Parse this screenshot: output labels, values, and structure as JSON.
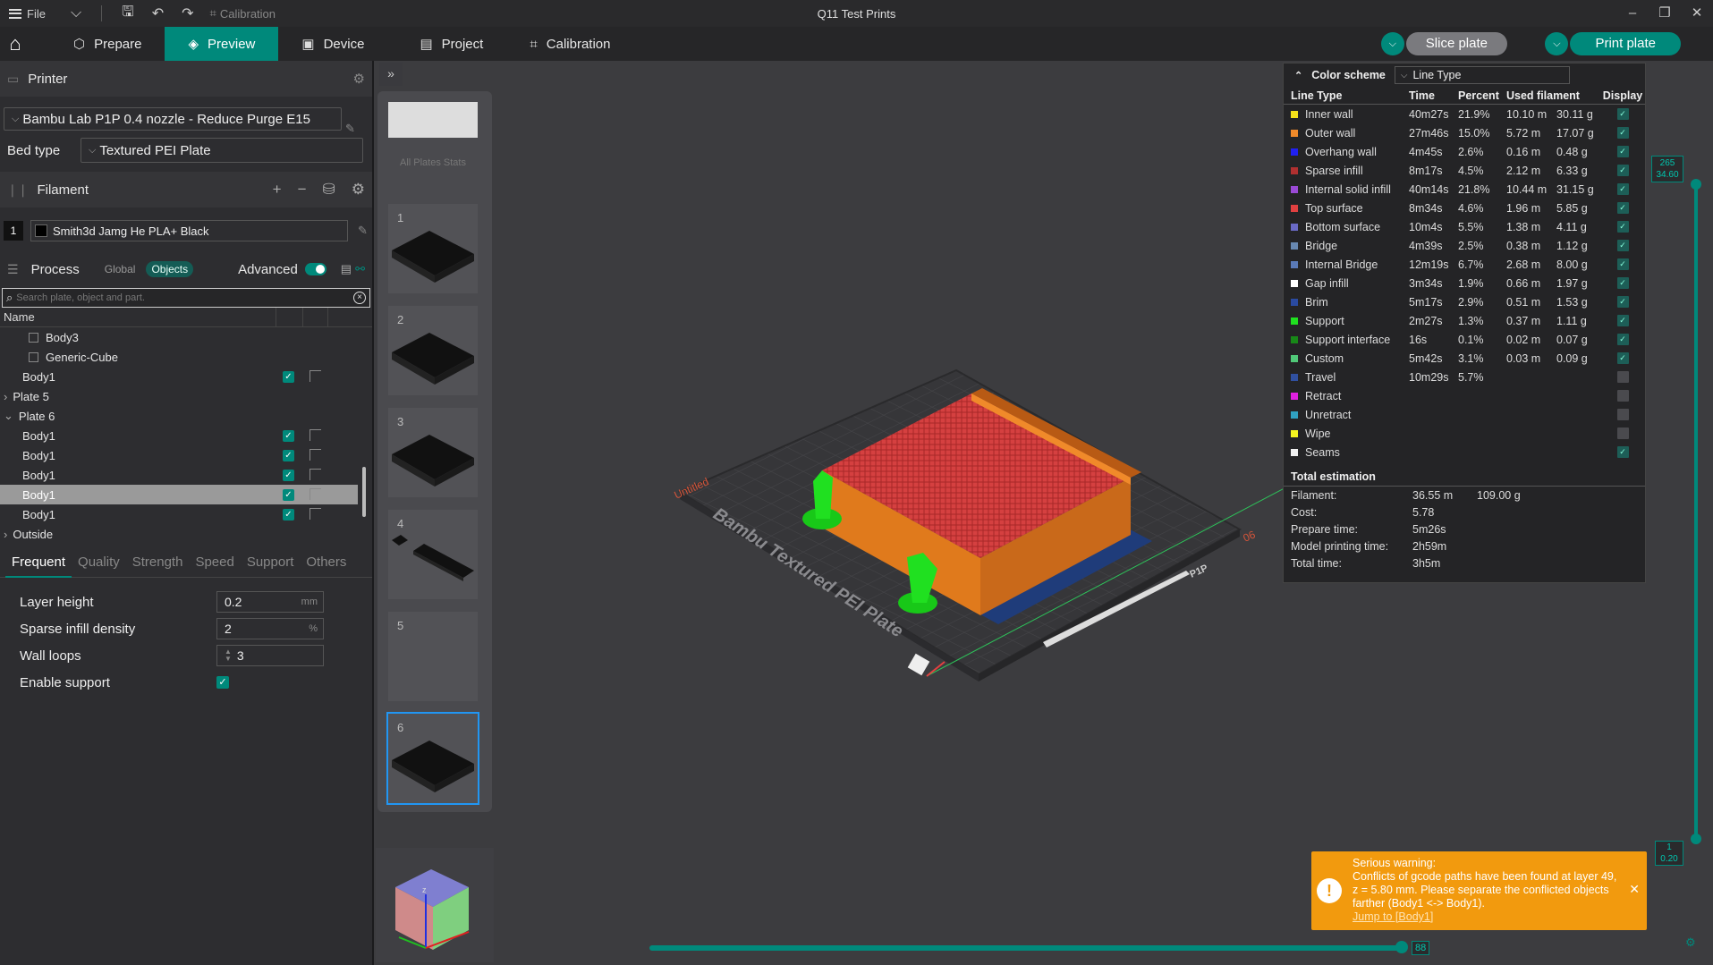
{
  "titlebar": {
    "file_label": "File",
    "calibration_label": "Calibration",
    "doc_title": "Q11 Test Prints"
  },
  "tabs": {
    "prepare": "Prepare",
    "preview": "Preview",
    "device": "Device",
    "project": "Project",
    "calibration": "Calibration",
    "slice_plate": "Slice plate",
    "print_plate": "Print plate"
  },
  "printer": {
    "section_title": "Printer",
    "preset": "Bambu Lab P1P 0.4 nozzle - Reduce Purge E15",
    "bed_type_label": "Bed type",
    "bed_type": "Textured PEI Plate"
  },
  "filament": {
    "section_title": "Filament",
    "slot": "1",
    "name": "Smith3d Jamg He PLA+ Black",
    "color": "#000000"
  },
  "process": {
    "section_title": "Process",
    "global": "Global",
    "objects": "Objects",
    "advanced": "Advanced",
    "search_placeholder": "Search plate, object and part.",
    "name_header": "Name",
    "tree": [
      "Body3",
      "Generic-Cube",
      "Body1",
      "Plate 5",
      "Plate 6",
      "Body1",
      "Body1",
      "Body1",
      "Body1",
      "Body1",
      "Outside"
    ]
  },
  "param_tabs": [
    "Frequent",
    "Quality",
    "Strength",
    "Speed",
    "Support",
    "Others"
  ],
  "params": {
    "layer_height_label": "Layer height",
    "layer_height": "0.2",
    "layer_height_unit": "mm",
    "sparse_infill_label": "Sparse infill density",
    "sparse_infill": "2",
    "sparse_infill_unit": "%",
    "wall_loops_label": "Wall loops",
    "wall_loops": "3",
    "enable_support_label": "Enable support"
  },
  "plates": {
    "all_label": "All Plates Stats",
    "numbers": [
      "1",
      "2",
      "3",
      "4",
      "5",
      "6"
    ]
  },
  "bed": {
    "plate_text": "Bambu Textured PEI Plate",
    "untitled": "Untitled",
    "plate_number": "06",
    "model_label": "P1P"
  },
  "legend": {
    "color_scheme_label": "Color scheme",
    "color_scheme": "Line Type",
    "headers": [
      "Line Type",
      "Time",
      "Percent",
      "Used filament",
      "Display"
    ],
    "rows": [
      {
        "name": "Inner wall",
        "time": "40m27s",
        "pct": "21.9%",
        "len": "10.10 m",
        "wt": "30.11 g",
        "color": "#f5e11a",
        "on": true
      },
      {
        "name": "Outer wall",
        "time": "27m46s",
        "pct": "15.0%",
        "len": "5.72 m",
        "wt": "17.07 g",
        "color": "#f08a2a",
        "on": true
      },
      {
        "name": "Overhang wall",
        "time": "4m45s",
        "pct": "2.6%",
        "len": "0.16 m",
        "wt": "0.48 g",
        "color": "#2020f0",
        "on": true
      },
      {
        "name": "Sparse infill",
        "time": "8m17s",
        "pct": "4.5%",
        "len": "2.12 m",
        "wt": "6.33 g",
        "color": "#b03030",
        "on": true
      },
      {
        "name": "Internal solid infill",
        "time": "40m14s",
        "pct": "21.8%",
        "len": "10.44 m",
        "wt": "31.15 g",
        "color": "#9a4ad6",
        "on": true
      },
      {
        "name": "Top surface",
        "time": "8m34s",
        "pct": "4.6%",
        "len": "1.96 m",
        "wt": "5.85 g",
        "color": "#e04040",
        "on": true
      },
      {
        "name": "Bottom surface",
        "time": "10m4s",
        "pct": "5.5%",
        "len": "1.38 m",
        "wt": "4.11 g",
        "color": "#6a6ac6",
        "on": true
      },
      {
        "name": "Bridge",
        "time": "4m39s",
        "pct": "2.5%",
        "len": "0.38 m",
        "wt": "1.12 g",
        "color": "#6888b0",
        "on": true
      },
      {
        "name": "Internal Bridge",
        "time": "12m19s",
        "pct": "6.7%",
        "len": "2.68 m",
        "wt": "8.00 g",
        "color": "#5a7ab8",
        "on": true
      },
      {
        "name": "Gap infill",
        "time": "3m34s",
        "pct": "1.9%",
        "len": "0.66 m",
        "wt": "1.97 g",
        "color": "#ffffff",
        "on": true
      },
      {
        "name": "Brim",
        "time": "5m17s",
        "pct": "2.9%",
        "len": "0.51 m",
        "wt": "1.53 g",
        "color": "#2a4aa0",
        "on": true
      },
      {
        "name": "Support",
        "time": "2m27s",
        "pct": "1.3%",
        "len": "0.37 m",
        "wt": "1.11 g",
        "color": "#20e020",
        "on": true
      },
      {
        "name": "Support interface",
        "time": "16s",
        "pct": "0.1%",
        "len": "0.02 m",
        "wt": "0.07 g",
        "color": "#188818",
        "on": true
      },
      {
        "name": "Custom",
        "time": "5m42s",
        "pct": "3.1%",
        "len": "0.03 m",
        "wt": "0.09 g",
        "color": "#50c878",
        "on": true
      },
      {
        "name": "Travel",
        "time": "10m29s",
        "pct": "5.7%",
        "len": "",
        "wt": "",
        "color": "#3050a0",
        "on": false
      },
      {
        "name": "Retract",
        "time": "",
        "pct": "",
        "len": "",
        "wt": "",
        "color": "#e020e0",
        "on": false
      },
      {
        "name": "Unretract",
        "time": "",
        "pct": "",
        "len": "",
        "wt": "",
        "color": "#30a0c0",
        "on": false
      },
      {
        "name": "Wipe",
        "time": "",
        "pct": "",
        "len": "",
        "wt": "",
        "color": "#f5f520",
        "on": false
      },
      {
        "name": "Seams",
        "time": "",
        "pct": "",
        "len": "",
        "wt": "",
        "color": "#f0f0f0",
        "on": true
      }
    ],
    "total_label": "Total estimation",
    "totals": {
      "filament_label": "Filament:",
      "filament_len": "36.55 m",
      "filament_wt": "109.00 g",
      "cost_label": "Cost:",
      "cost": "5.78",
      "prepare_label": "Prepare time:",
      "prepare": "5m26s",
      "model_label": "Model printing time:",
      "model": "2h59m",
      "total_label": "Total time:",
      "total": "3h5m"
    }
  },
  "sliders": {
    "top_max": "265",
    "top_height": "34.60",
    "bottom_layer": "1",
    "bottom_height": "0.20",
    "moves": "88",
    "vertical_level": 1.0,
    "horizontal_level": 1.0
  },
  "warning": {
    "title": "Serious warning:",
    "message": "Conflicts of gcode paths have been found at layer 49, z = 5.80 mm. Please separate the conflicted objects farther (Body1 <-> Body1).",
    "link": "Jump to [Body1]"
  },
  "colors": {
    "accent": "#00897b",
    "warning": "#f29a0e"
  }
}
